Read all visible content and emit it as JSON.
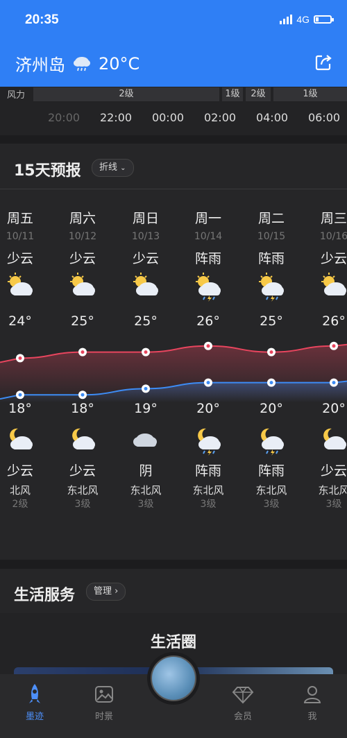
{
  "status": {
    "time": "20:35",
    "network": "4G"
  },
  "header": {
    "city": "济州岛",
    "temp": "20°C",
    "weather_icon": "rain-cloud-icon",
    "share_icon": "share-icon"
  },
  "hourly": {
    "wind_label": "风力",
    "wind_segments": [
      "2级",
      "1级",
      "2级",
      "1级"
    ],
    "times": [
      "20:00",
      "22:00",
      "00:00",
      "02:00",
      "04:00",
      "06:00"
    ]
  },
  "forecast": {
    "title": "15天预报",
    "view_toggle": "折线",
    "days": [
      {
        "dow": "周五",
        "date": "10/11",
        "day_cond": "少云",
        "hi": "24°",
        "lo": "18°",
        "night_cond": "少云",
        "wind_dir": "北风",
        "wind_lvl": "2级",
        "day_icon": "partly-cloudy-sun-icon",
        "night_icon": "partly-cloudy-moon-icon"
      },
      {
        "dow": "周六",
        "date": "10/12",
        "day_cond": "少云",
        "hi": "25°",
        "lo": "18°",
        "night_cond": "少云",
        "wind_dir": "东北风",
        "wind_lvl": "3级",
        "day_icon": "partly-cloudy-sun-icon",
        "night_icon": "partly-cloudy-moon-icon"
      },
      {
        "dow": "周日",
        "date": "10/13",
        "day_cond": "少云",
        "hi": "25°",
        "lo": "19°",
        "night_cond": "阴",
        "wind_dir": "东北风",
        "wind_lvl": "3级",
        "day_icon": "partly-cloudy-sun-icon",
        "night_icon": "overcast-cloud-icon"
      },
      {
        "dow": "周一",
        "date": "10/14",
        "day_cond": "阵雨",
        "hi": "26°",
        "lo": "20°",
        "night_cond": "阵雨",
        "wind_dir": "东北风",
        "wind_lvl": "3级",
        "day_icon": "shower-sun-icon",
        "night_icon": "shower-moon-icon"
      },
      {
        "dow": "周二",
        "date": "10/15",
        "day_cond": "阵雨",
        "hi": "25°",
        "lo": "20°",
        "night_cond": "阵雨",
        "wind_dir": "东北风",
        "wind_lvl": "3级",
        "day_icon": "shower-sun-icon",
        "night_icon": "shower-moon-icon"
      },
      {
        "dow": "周三",
        "date": "10/16",
        "day_cond": "少云",
        "hi": "26°",
        "lo": "20°",
        "night_cond": "少云",
        "wind_dir": "东北风",
        "wind_lvl": "3级",
        "day_icon": "partly-cloudy-sun-icon",
        "night_icon": "partly-cloudy-moon-icon"
      }
    ],
    "high_values": [
      24,
      25,
      25,
      26,
      25,
      26
    ],
    "low_values": [
      18,
      18,
      19,
      20,
      20,
      20
    ],
    "colors": {
      "high": "#e8455e",
      "low": "#3d8cf5"
    }
  },
  "services": {
    "title": "生活服务",
    "manage": "管理"
  },
  "circle": {
    "title": "生活圈"
  },
  "tabbar": {
    "tabs": [
      {
        "label": "墨迹",
        "icon": "rocket-icon"
      },
      {
        "label": "时景",
        "icon": "photo-icon"
      },
      {
        "label": "会员",
        "icon": "diamond-icon"
      },
      {
        "label": "我",
        "icon": "user-icon"
      }
    ]
  }
}
